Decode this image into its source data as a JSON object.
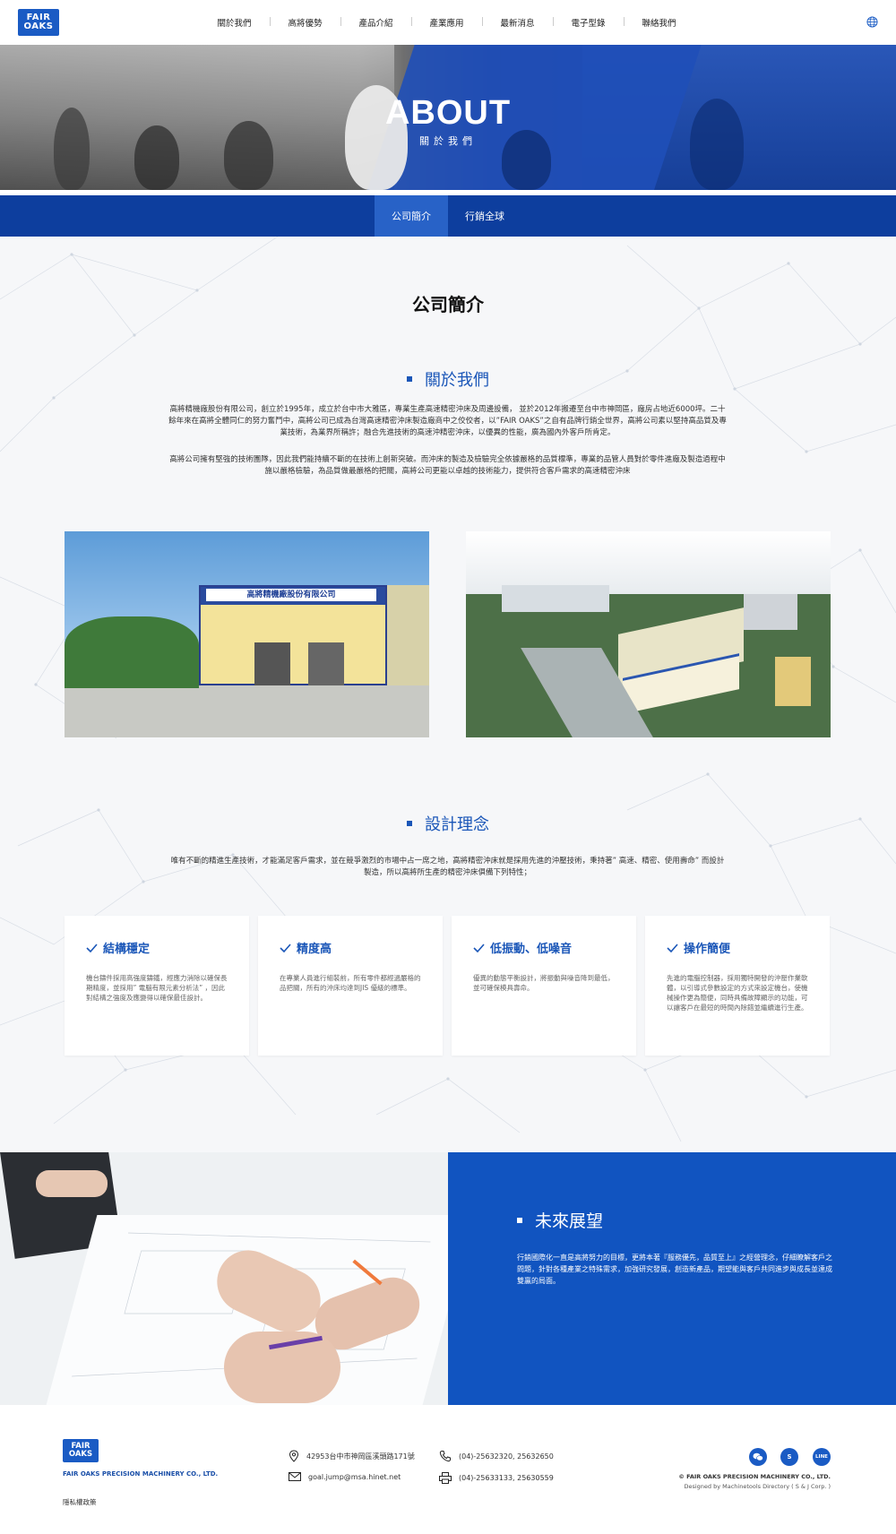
{
  "header": {
    "logo_line1": "FAIR",
    "logo_line2": "OAKS",
    "nav": [
      "關於我們",
      "高將優勢",
      "產品介紹",
      "產業應用",
      "最新消息",
      "電子型錄",
      "聯絡我們"
    ],
    "language_icon": "globe-icon"
  },
  "hero": {
    "title": "ABOUT",
    "subtitle": "關於我們"
  },
  "subnav": {
    "tabs": [
      "公司簡介",
      "行銷全球"
    ],
    "active_index": 0
  },
  "intro": {
    "section_title": "公司簡介",
    "about_heading": "關於我們",
    "about_para1": "高將精機廠股份有限公司，創立於1995年，成立於台中市大雅區，專業生產高速精密沖床及周邊設備， 並於2012年搬遷至台中市神岡區，廠房占地近6000坪。二十餘年來在高將全體同仁的努力奮鬥中，高將公司已成為台灣高速精密沖床製造廠商中之佼佼者，以”FAIR OAKS”之自有品牌行銷全世界，高將公司素以堅持高品質及專業技術，為業界所稱許；融合先進技術的高速沖精密沖床，以優異的性能，廣為國內外客戶所肯定。",
    "about_para2": "高將公司擁有堅強的技術團隊，因此我們能持續不斷的在技術上創新突破。而沖床的製造及檢驗完全依據嚴格的品質標準，專業的品管人員對於零件進廠及製造過程中施以嚴格檢驗，為品質做最嚴格的把關，高將公司更能以卓越的技術能力，提供符合客戶需求的高速精密沖床",
    "building_sign": "高將精機廠股份有限公司"
  },
  "design": {
    "heading": "設計理念",
    "para": "唯有不斷的精進生產技術，才能滿足客戶需求，並在競爭激烈的市場中占一席之地，高將精密沖床就是採用先進的沖壓技術，秉持著” 高速、精密、使用壽命” 而設計製造，所以高將所生產的精密沖床俱備下列特性；",
    "cards": [
      {
        "title": "結構穩定",
        "text": "機台鑄件採用高強度鑄鐵，經應力消除以確保長期精度，並採用” 電腦有限元素分析法” ，因此對結構之強度及應變得以確保最佳設計。"
      },
      {
        "title": "精度高",
        "text": "在專業人員進行組裝前，所有零件都經過嚴格的品把關，所有的沖床均達到JIS 優級的標準。"
      },
      {
        "title": "低振動、低噪音",
        "text": "優異的動態平衡設計，將振動與噪音降到最低，並可確保模具壽命。"
      },
      {
        "title": "操作簡便",
        "text": "先進的電腦控制器，採用獨特開發的沖壓作業軟體，以引導式參數設定的方式來設定機台，使機械操作更為簡便，同時具備故障顯示的功能，可以讓客戶在最短的時間內除錯並繼續進行生產。"
      }
    ]
  },
  "future": {
    "heading": "未來展望",
    "text": "行銷國際化一直是高將努力的目標，更將本著『服務優先，品質至上』之經營理念，仔細瞭解客戶之問題，針對各種產業之特殊需求，加強研究發展，創造新產品，期望能與客戶共同進步與成長並達成雙贏的局面。"
  },
  "footer": {
    "logo_line1": "FAIR",
    "logo_line2": "OAKS",
    "company": "FAIR OAKS PRECISION MACHINERY CO., LTD.",
    "privacy": "隱私權政策",
    "address": "42953台中市神岡區溪頭路171號",
    "email": "goal.jump@msa.hinet.net",
    "phone": "(04)-25632320, 25632650",
    "fax": "(04)-25633133, 25630559",
    "copyright": "© FAIR OAKS PRECISION MACHINERY CO., LTD.",
    "designed_by": "Designed by Machinetools Directory ( S & J Corp. )",
    "social": [
      {
        "icon": "wechat-icon",
        "label": ""
      },
      {
        "icon": "skype-icon",
        "label": "S"
      },
      {
        "icon": "line-icon",
        "label": "LINE"
      }
    ]
  },
  "colors": {
    "brand_blue": "#1154c0",
    "subnav_blue": "#0d3e9e",
    "subnav_active": "#2862c7",
    "background": "#f6f7f9"
  }
}
